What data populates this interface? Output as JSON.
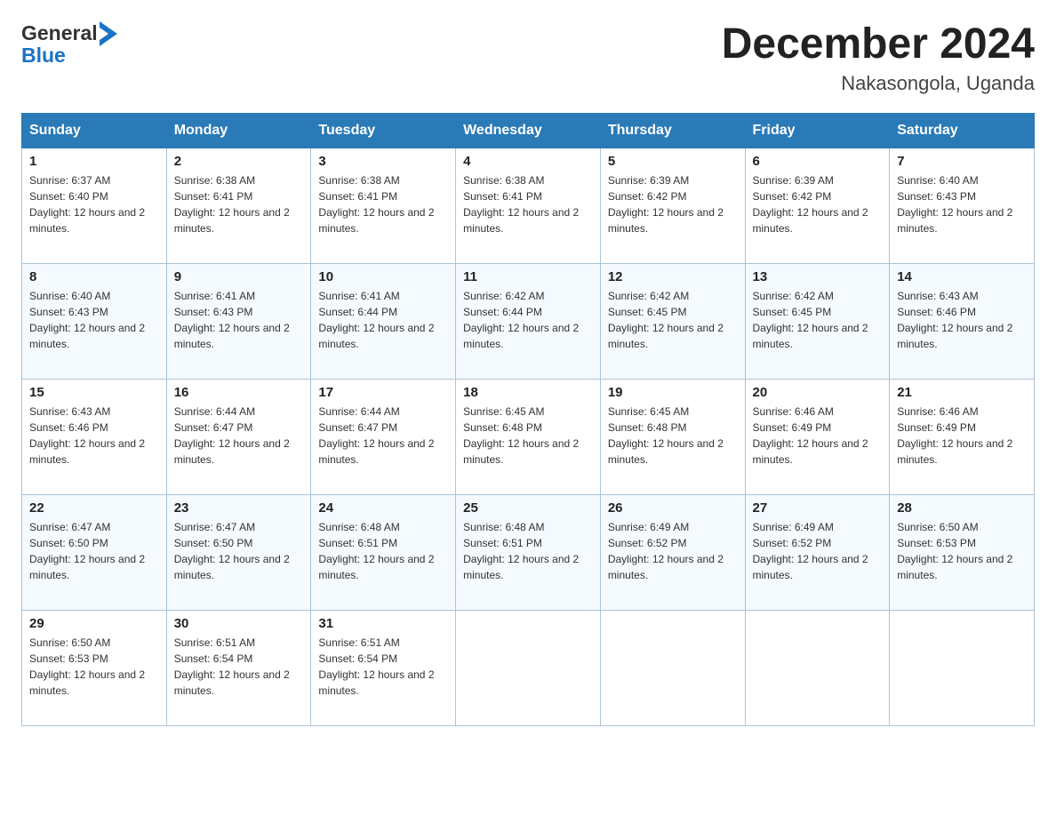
{
  "header": {
    "logo": {
      "text_general": "General",
      "text_blue": "Blue"
    },
    "title": "December 2024",
    "location": "Nakasongola, Uganda"
  },
  "calendar": {
    "days_of_week": [
      "Sunday",
      "Monday",
      "Tuesday",
      "Wednesday",
      "Thursday",
      "Friday",
      "Saturday"
    ],
    "weeks": [
      [
        {
          "day": "1",
          "sunrise": "6:37 AM",
          "sunset": "6:40 PM",
          "daylight": "12 hours and 2 minutes."
        },
        {
          "day": "2",
          "sunrise": "6:38 AM",
          "sunset": "6:41 PM",
          "daylight": "12 hours and 2 minutes."
        },
        {
          "day": "3",
          "sunrise": "6:38 AM",
          "sunset": "6:41 PM",
          "daylight": "12 hours and 2 minutes."
        },
        {
          "day": "4",
          "sunrise": "6:38 AM",
          "sunset": "6:41 PM",
          "daylight": "12 hours and 2 minutes."
        },
        {
          "day": "5",
          "sunrise": "6:39 AM",
          "sunset": "6:42 PM",
          "daylight": "12 hours and 2 minutes."
        },
        {
          "day": "6",
          "sunrise": "6:39 AM",
          "sunset": "6:42 PM",
          "daylight": "12 hours and 2 minutes."
        },
        {
          "day": "7",
          "sunrise": "6:40 AM",
          "sunset": "6:43 PM",
          "daylight": "12 hours and 2 minutes."
        }
      ],
      [
        {
          "day": "8",
          "sunrise": "6:40 AM",
          "sunset": "6:43 PM",
          "daylight": "12 hours and 2 minutes."
        },
        {
          "day": "9",
          "sunrise": "6:41 AM",
          "sunset": "6:43 PM",
          "daylight": "12 hours and 2 minutes."
        },
        {
          "day": "10",
          "sunrise": "6:41 AM",
          "sunset": "6:44 PM",
          "daylight": "12 hours and 2 minutes."
        },
        {
          "day": "11",
          "sunrise": "6:42 AM",
          "sunset": "6:44 PM",
          "daylight": "12 hours and 2 minutes."
        },
        {
          "day": "12",
          "sunrise": "6:42 AM",
          "sunset": "6:45 PM",
          "daylight": "12 hours and 2 minutes."
        },
        {
          "day": "13",
          "sunrise": "6:42 AM",
          "sunset": "6:45 PM",
          "daylight": "12 hours and 2 minutes."
        },
        {
          "day": "14",
          "sunrise": "6:43 AM",
          "sunset": "6:46 PM",
          "daylight": "12 hours and 2 minutes."
        }
      ],
      [
        {
          "day": "15",
          "sunrise": "6:43 AM",
          "sunset": "6:46 PM",
          "daylight": "12 hours and 2 minutes."
        },
        {
          "day": "16",
          "sunrise": "6:44 AM",
          "sunset": "6:47 PM",
          "daylight": "12 hours and 2 minutes."
        },
        {
          "day": "17",
          "sunrise": "6:44 AM",
          "sunset": "6:47 PM",
          "daylight": "12 hours and 2 minutes."
        },
        {
          "day": "18",
          "sunrise": "6:45 AM",
          "sunset": "6:48 PM",
          "daylight": "12 hours and 2 minutes."
        },
        {
          "day": "19",
          "sunrise": "6:45 AM",
          "sunset": "6:48 PM",
          "daylight": "12 hours and 2 minutes."
        },
        {
          "day": "20",
          "sunrise": "6:46 AM",
          "sunset": "6:49 PM",
          "daylight": "12 hours and 2 minutes."
        },
        {
          "day": "21",
          "sunrise": "6:46 AM",
          "sunset": "6:49 PM",
          "daylight": "12 hours and 2 minutes."
        }
      ],
      [
        {
          "day": "22",
          "sunrise": "6:47 AM",
          "sunset": "6:50 PM",
          "daylight": "12 hours and 2 minutes."
        },
        {
          "day": "23",
          "sunrise": "6:47 AM",
          "sunset": "6:50 PM",
          "daylight": "12 hours and 2 minutes."
        },
        {
          "day": "24",
          "sunrise": "6:48 AM",
          "sunset": "6:51 PM",
          "daylight": "12 hours and 2 minutes."
        },
        {
          "day": "25",
          "sunrise": "6:48 AM",
          "sunset": "6:51 PM",
          "daylight": "12 hours and 2 minutes."
        },
        {
          "day": "26",
          "sunrise": "6:49 AM",
          "sunset": "6:52 PM",
          "daylight": "12 hours and 2 minutes."
        },
        {
          "day": "27",
          "sunrise": "6:49 AM",
          "sunset": "6:52 PM",
          "daylight": "12 hours and 2 minutes."
        },
        {
          "day": "28",
          "sunrise": "6:50 AM",
          "sunset": "6:53 PM",
          "daylight": "12 hours and 2 minutes."
        }
      ],
      [
        {
          "day": "29",
          "sunrise": "6:50 AM",
          "sunset": "6:53 PM",
          "daylight": "12 hours and 2 minutes."
        },
        {
          "day": "30",
          "sunrise": "6:51 AM",
          "sunset": "6:54 PM",
          "daylight": "12 hours and 2 minutes."
        },
        {
          "day": "31",
          "sunrise": "6:51 AM",
          "sunset": "6:54 PM",
          "daylight": "12 hours and 2 minutes."
        },
        null,
        null,
        null,
        null
      ]
    ]
  }
}
